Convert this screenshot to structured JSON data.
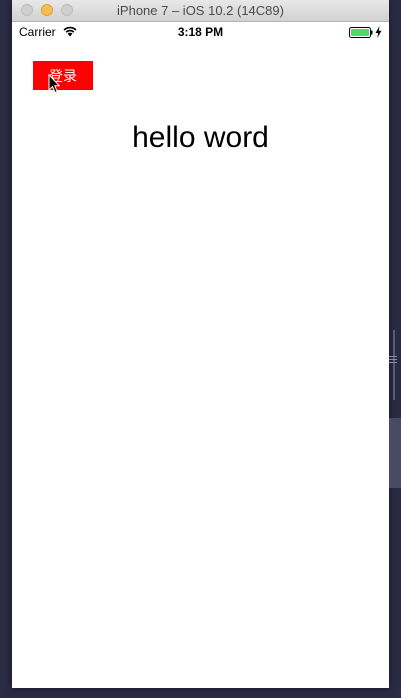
{
  "window": {
    "title": "iPhone 7 – iOS 10.2 (14C89)"
  },
  "status_bar": {
    "carrier": "Carrier",
    "time": "3:18 PM",
    "battery_color": "#4cd964"
  },
  "app": {
    "login_button_label": "登录",
    "login_button_color": "#ff0000",
    "hello_text": "hello word"
  },
  "icons": {
    "wifi": "wifi-icon",
    "battery": "battery-icon",
    "charging": "bolt-icon",
    "cursor": "mouse-pointer-icon"
  }
}
